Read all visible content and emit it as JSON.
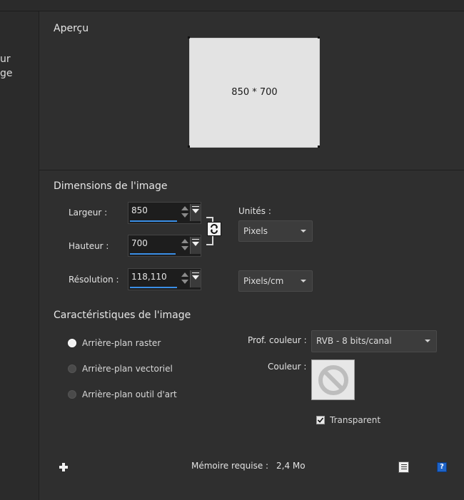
{
  "left_panel": {
    "line1": "ur",
    "line2": "ge"
  },
  "preview": {
    "title": "Aperçu",
    "size_label": "850 * 700"
  },
  "dimensions": {
    "title": "Dimensions de l'image",
    "width_label": "Largeur :",
    "width_value": "850",
    "height_label": "Hauteur :",
    "height_value": "700",
    "resolution_label": "Résolution :",
    "resolution_value": "118,110",
    "units_label": "Unités :",
    "units_value": "Pixels",
    "resolution_units_value": "Pixels/cm"
  },
  "characteristics": {
    "title": "Caractéristiques de l'image",
    "background_options": [
      {
        "label": "Arrière-plan raster",
        "checked": true
      },
      {
        "label": "Arrière-plan vectoriel",
        "checked": false
      },
      {
        "label": "Arrière-plan outil d'art",
        "checked": false
      }
    ],
    "color_depth_label": "Prof. couleur :",
    "color_depth_value": "RVB - 8 bits/canal",
    "color_label": "Couleur :",
    "transparent_label": "Transparent",
    "transparent_checked": true
  },
  "footer": {
    "memory_label": "Mémoire requise :",
    "memory_value": "2,4 Mo"
  }
}
